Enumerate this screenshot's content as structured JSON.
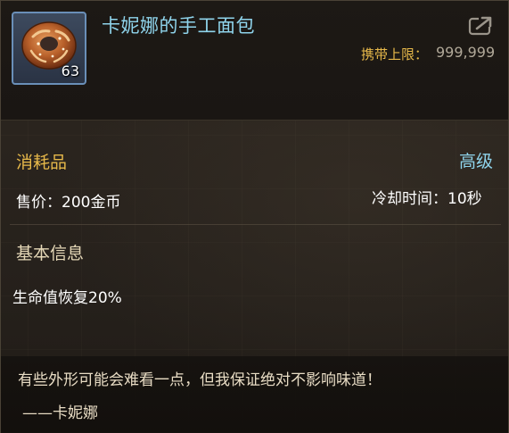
{
  "item": {
    "name": "卡妮娜的手工面包",
    "count": "63",
    "icon": "bread-donut-icon"
  },
  "header": {
    "carry_limit_label": "携带上限：",
    "carry_limit_value": "999,999",
    "share_icon": "share-export-icon"
  },
  "info": {
    "category": "消耗品",
    "grade": "高级",
    "price": "售价：200金币",
    "cooldown": "冷却时间：10秒"
  },
  "basic": {
    "title": "基本信息",
    "effect": "生命值恢复20%"
  },
  "flavor": {
    "quote": "有些外形可能会难看一点，但我保证绝对不影响味道！",
    "signature": "——卡妮娜"
  },
  "colors": {
    "item_name": "#8fd4ec",
    "gold_label": "#e6b84a",
    "grade": "#8fd4ec",
    "icon_border": "#6a8fb8"
  }
}
